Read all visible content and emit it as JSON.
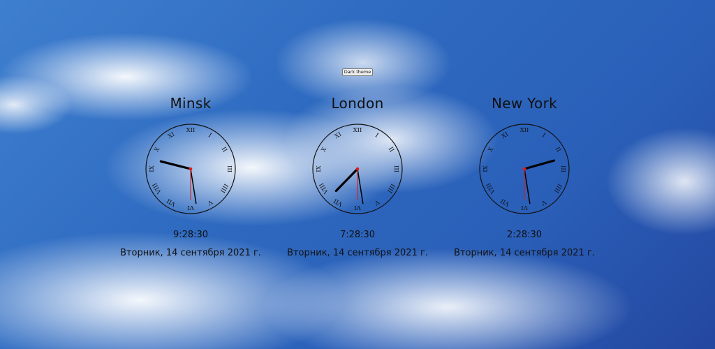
{
  "theme_button": {
    "label": "Dark theme"
  },
  "clocks": [
    {
      "city": "Minsk",
      "time": "9:28:30",
      "date": "Вторник, 14 сентября 2021 г.",
      "hours": 9,
      "minutes": 28,
      "seconds": 30
    },
    {
      "city": "London",
      "time": "7:28:30",
      "date": "Вторник, 14 сентября 2021 г.",
      "hours": 7,
      "minutes": 28,
      "seconds": 30
    },
    {
      "city": "New York",
      "time": "2:28:30",
      "date": "Вторник, 14 сентября 2021 г.",
      "hours": 2,
      "minutes": 28,
      "seconds": 30
    }
  ],
  "dial_numerals": [
    "XII",
    "I",
    "II",
    "III",
    "IIII",
    "V",
    "VI",
    "VII",
    "VIII",
    "IX",
    "X",
    "XI"
  ],
  "colors": {
    "second_hand": "#e0191b",
    "hands": "#000000",
    "dial_ring": "#111111"
  }
}
